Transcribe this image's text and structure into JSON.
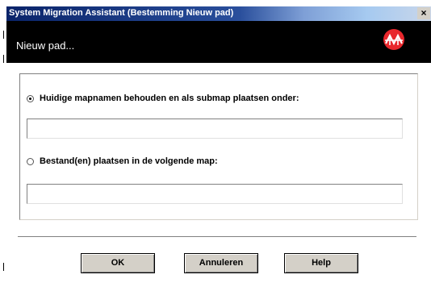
{
  "window": {
    "title": "System Migration Assistant (Bestemming Nieuw pad)",
    "close_glyph": "×"
  },
  "header": {
    "title": "Nieuw pad...",
    "logo_icon": "smart-migration-logo",
    "logo_color": "#e8272c"
  },
  "options": [
    {
      "label": "Huidige mapnamen behouden en als submap plaatsen onder:",
      "selected": true,
      "value": ""
    },
    {
      "label": "Bestand(en) plaatsen in de volgende map:",
      "selected": false,
      "value": ""
    }
  ],
  "buttons": {
    "ok": "OK",
    "cancel": "Annuleren",
    "help": "Help"
  },
  "colors": {
    "titlebar_start": "#0a246a",
    "header_bg": "#000000",
    "button_face": "#d4d0c8"
  }
}
